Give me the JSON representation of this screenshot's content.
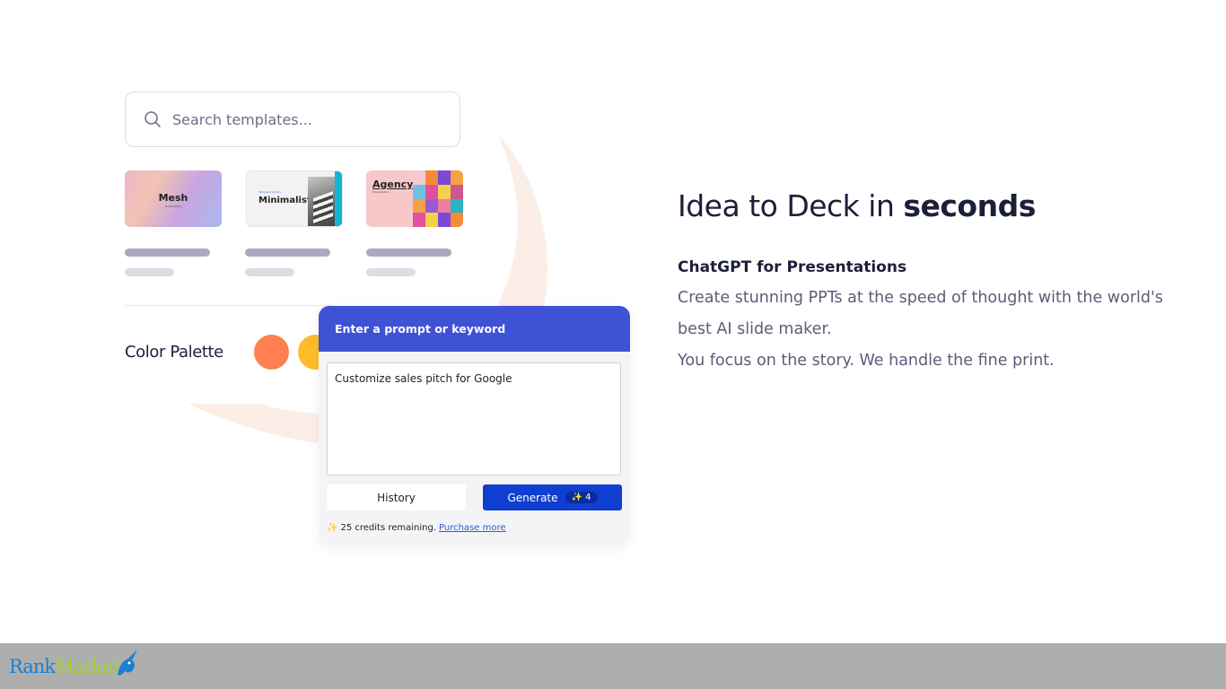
{
  "search": {
    "placeholder": "Search templates..."
  },
  "templates": [
    {
      "title": "Mesh",
      "subtitle": "Presentation"
    },
    {
      "title": "Minimalist",
      "subtitle": "Template Library"
    },
    {
      "title": "Agency",
      "subtitle": "Presentation"
    }
  ],
  "palette": {
    "label": "Color Palette",
    "colors": [
      "#ff7f50",
      "#fdbd2a"
    ]
  },
  "prompt_card": {
    "header": "Enter a prompt or keyword",
    "input_value": "Customize sales pitch for Google",
    "history_label": "History",
    "generate_label": "Generate",
    "generate_cost": "✨ 4",
    "credits_text": "25 credits remaining.",
    "purchase_link": "Purchase more"
  },
  "hero": {
    "headline_prefix": "Idea to Deck in ",
    "headline_bold": "seconds",
    "subheading": "ChatGPT for Presentations",
    "description_lines": [
      "Create stunning PPTs at the speed of thought with the world's",
      "best AI slide maker.",
      "You focus on the story. We handle the fine print."
    ]
  },
  "footer": {
    "logo_part1": "Rank",
    "logo_part2": "Market"
  },
  "colors": {
    "accent_blue": "#3f52d6",
    "generate_blue": "#0f3fd0",
    "text_dark": "#1c1f3a",
    "footer_gray": "#aeaeae"
  }
}
